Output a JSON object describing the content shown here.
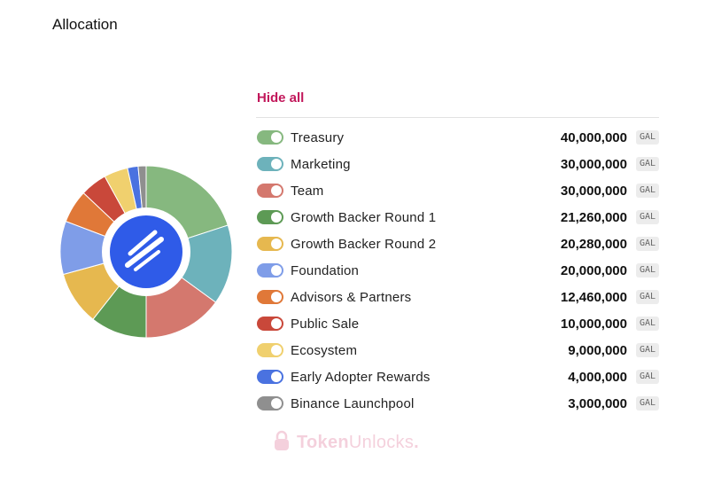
{
  "header": {
    "title": "Allocation"
  },
  "controls": {
    "hide_all_label": "Hide all"
  },
  "unit_label": "GAL",
  "allocations": [
    {
      "label": "Treasury",
      "value": "40,000,000",
      "amount": 40000000,
      "color": "#86b87f"
    },
    {
      "label": "Marketing",
      "value": "30,000,000",
      "amount": 30000000,
      "color": "#6db2bb"
    },
    {
      "label": "Team",
      "value": "30,000,000",
      "amount": 30000000,
      "color": "#d4786e"
    },
    {
      "label": "Growth Backer Round 1",
      "value": "21,260,000",
      "amount": 21260000,
      "color": "#5d9a55"
    },
    {
      "label": "Growth Backer Round 2",
      "value": "20,280,000",
      "amount": 20280000,
      "color": "#e6b84f"
    },
    {
      "label": "Foundation",
      "value": "20,000,000",
      "amount": 20000000,
      "color": "#7f9de8"
    },
    {
      "label": "Advisors & Partners",
      "value": "12,460,000",
      "amount": 12460000,
      "color": "#e07838"
    },
    {
      "label": "Public Sale",
      "value": "10,000,000",
      "amount": 10000000,
      "color": "#c9483a"
    },
    {
      "label": "Ecosystem",
      "value": "9,000,000",
      "amount": 9000000,
      "color": "#f0d06e"
    },
    {
      "label": "Early Adopter Rewards",
      "value": "4,000,000",
      "amount": 4000000,
      "color": "#4a72e0"
    },
    {
      "label": "Binance Launchpool",
      "value": "3,000,000",
      "amount": 3000000,
      "color": "#8f8f8f"
    }
  ],
  "center_logo": {
    "icon": "galxe-logo-icon",
    "color": "#2f5be8"
  },
  "watermark": {
    "brand_part1": "Token",
    "brand_part2": "Unlocks",
    "brand_dot": ".",
    "icon": "lock-icon"
  },
  "chart_data": {
    "type": "pie",
    "title": "Allocation",
    "categories": [
      "Treasury",
      "Marketing",
      "Team",
      "Growth Backer Round 1",
      "Growth Backer Round 2",
      "Foundation",
      "Advisors & Partners",
      "Public Sale",
      "Ecosystem",
      "Early Adopter Rewards",
      "Binance Launchpool"
    ],
    "values": [
      40000000,
      30000000,
      30000000,
      21260000,
      20280000,
      20000000,
      12460000,
      10000000,
      9000000,
      4000000,
      3000000
    ],
    "unit": "GAL",
    "legend": "right"
  }
}
